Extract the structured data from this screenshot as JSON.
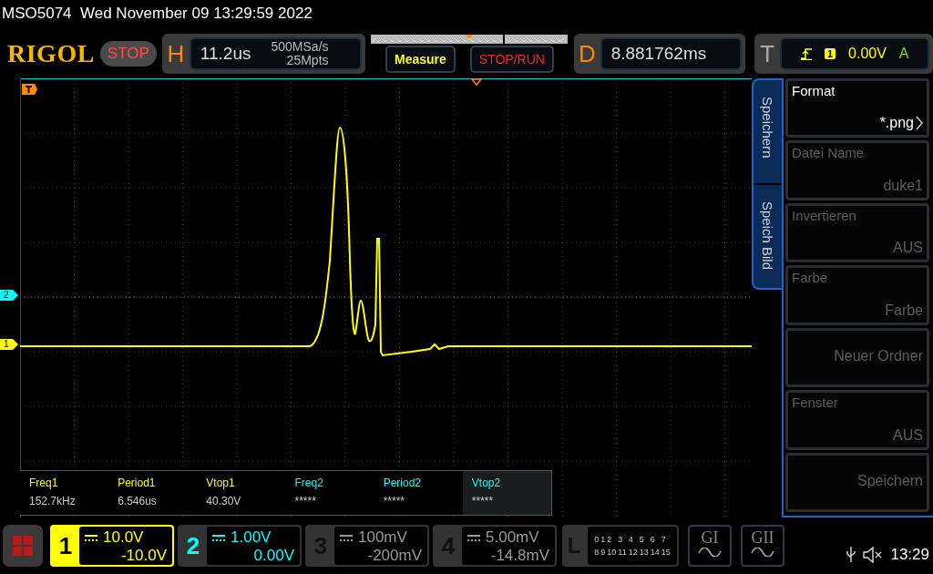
{
  "header": {
    "title": "MSO5074  Wed November 09 13:29:59 2022"
  },
  "toolbar": {
    "logo": "RIGOL",
    "run_status": "STOP",
    "horizontal": {
      "label": "H",
      "timebase": "11.2us",
      "sample_rate": "500MSa/s",
      "memory_depth": "25Mpts"
    },
    "buttons": [
      "Measure",
      "STOP/RUN"
    ],
    "delay": {
      "label": "D",
      "value": "8.881762ms"
    },
    "trigger": {
      "label": "T",
      "source": "1",
      "level": "0.00V",
      "mode": "A"
    }
  },
  "plot": {
    "channel_markers": [
      {
        "label": "2",
        "color": "#00ffff"
      },
      {
        "label": "1",
        "color": "#ffff00"
      }
    ]
  },
  "measurements": [
    {
      "name": "Freq1",
      "value": "152.7kHz",
      "color": "#ffff00",
      "selected": false
    },
    {
      "name": "Period1",
      "value": "6.546us",
      "color": "#ffff00",
      "selected": false
    },
    {
      "name": "Vtop1",
      "value": "40.30V",
      "color": "#ffff00",
      "selected": false
    },
    {
      "name": "Freq2",
      "value": "*****",
      "color": "#00ffff",
      "selected": false
    },
    {
      "name": "Period2",
      "value": "*****",
      "color": "#00ffff",
      "selected": false
    },
    {
      "name": "Vtop2",
      "value": "*****",
      "color": "#00ffff",
      "selected": true
    }
  ],
  "side_menu": {
    "tabs": [
      "Speichern",
      "Speich Bild"
    ],
    "items": [
      {
        "label": "Format",
        "value": "*.png",
        "disabled": false,
        "submenu": true
      },
      {
        "label": "Datei Name",
        "value": "duke1",
        "disabled": true,
        "submenu": false
      },
      {
        "label": "Invertieren",
        "value": "AUS",
        "disabled": true,
        "submenu": false
      },
      {
        "label": "Farbe",
        "value": "Farbe",
        "disabled": true,
        "submenu": false
      },
      {
        "value": "Neuer Ordner",
        "disabled": true,
        "submenu": false
      },
      {
        "label": "Fenster",
        "value": "AUS",
        "disabled": true,
        "submenu": false
      },
      {
        "value": "Speichern",
        "disabled": true,
        "submenu": false
      }
    ]
  },
  "channels": [
    {
      "number": "1",
      "scale": "10.0V",
      "offset": "-10.0V",
      "color": "#ffff00",
      "on": true,
      "selected": true
    },
    {
      "number": "2",
      "scale": "1.00V",
      "offset": "0.00V",
      "color": "#00ffff",
      "on": true,
      "selected": false
    },
    {
      "number": "3",
      "scale": "100mV",
      "offset": "-200mV",
      "on": false,
      "selected": false
    },
    {
      "number": "4",
      "scale": "5.00mV",
      "offset": "-14.8mV",
      "on": false,
      "selected": false
    }
  ],
  "logic": {
    "label": "L",
    "rows": [
      [
        "0",
        "1",
        "2",
        "3",
        "4",
        "5",
        "6",
        "7"
      ],
      [
        "8",
        "9",
        "10",
        "11",
        "12",
        "13",
        "14",
        "15"
      ]
    ]
  },
  "generators": [
    "GI",
    "GII"
  ],
  "status_bar": {
    "time": "13:29"
  }
}
